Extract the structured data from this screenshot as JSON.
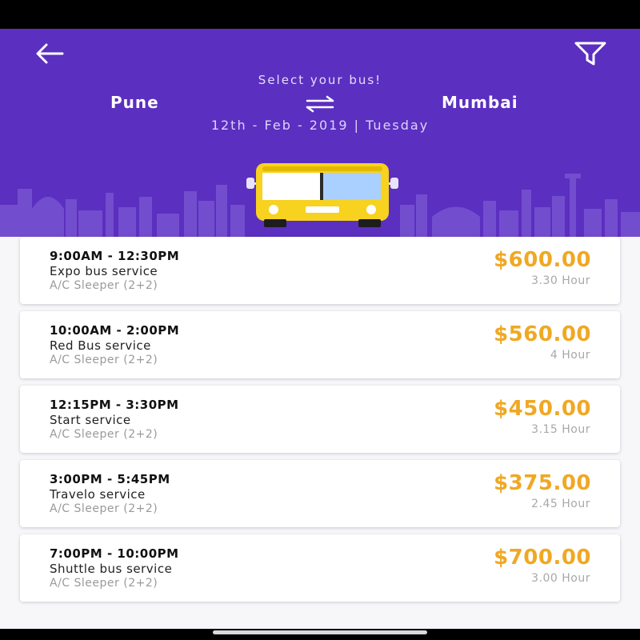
{
  "header": {
    "subtitle": "Select your bus!",
    "from_city": "Pune",
    "to_city": "Mumbai",
    "date": "12th - Feb - 2019 | Tuesday",
    "back_icon": "arrow-left-icon",
    "filter_icon": "filter-icon",
    "swap_icon": "swap-arrows-icon"
  },
  "colors": {
    "header_bg": "#5b2fc0",
    "price": "#f0a823",
    "bus_body": "#f7d21e"
  },
  "buses": [
    {
      "time": "9:00AM - 12:30PM",
      "operator": "Expo bus service",
      "seat_type": "A/C Sleeper (2+2)",
      "price": "$600.00",
      "duration": "3.30 Hour"
    },
    {
      "time": "10:00AM - 2:00PM",
      "operator": "Red Bus service",
      "seat_type": "A/C Sleeper (2+2)",
      "price": "$560.00",
      "duration": "4 Hour"
    },
    {
      "time": "12:15PM - 3:30PM",
      "operator": "Start service",
      "seat_type": "A/C Sleeper (2+2)",
      "price": "$450.00",
      "duration": "3.15 Hour"
    },
    {
      "time": "3:00PM - 5:45PM",
      "operator": "Travelo service",
      "seat_type": "A/C Sleeper (2+2)",
      "price": "$375.00",
      "duration": "2.45 Hour"
    },
    {
      "time": "7:00PM - 10:00PM",
      "operator": "Shuttle bus service",
      "seat_type": "A/C Sleeper (2+2)",
      "price": "$700.00",
      "duration": "3.00 Hour"
    }
  ]
}
